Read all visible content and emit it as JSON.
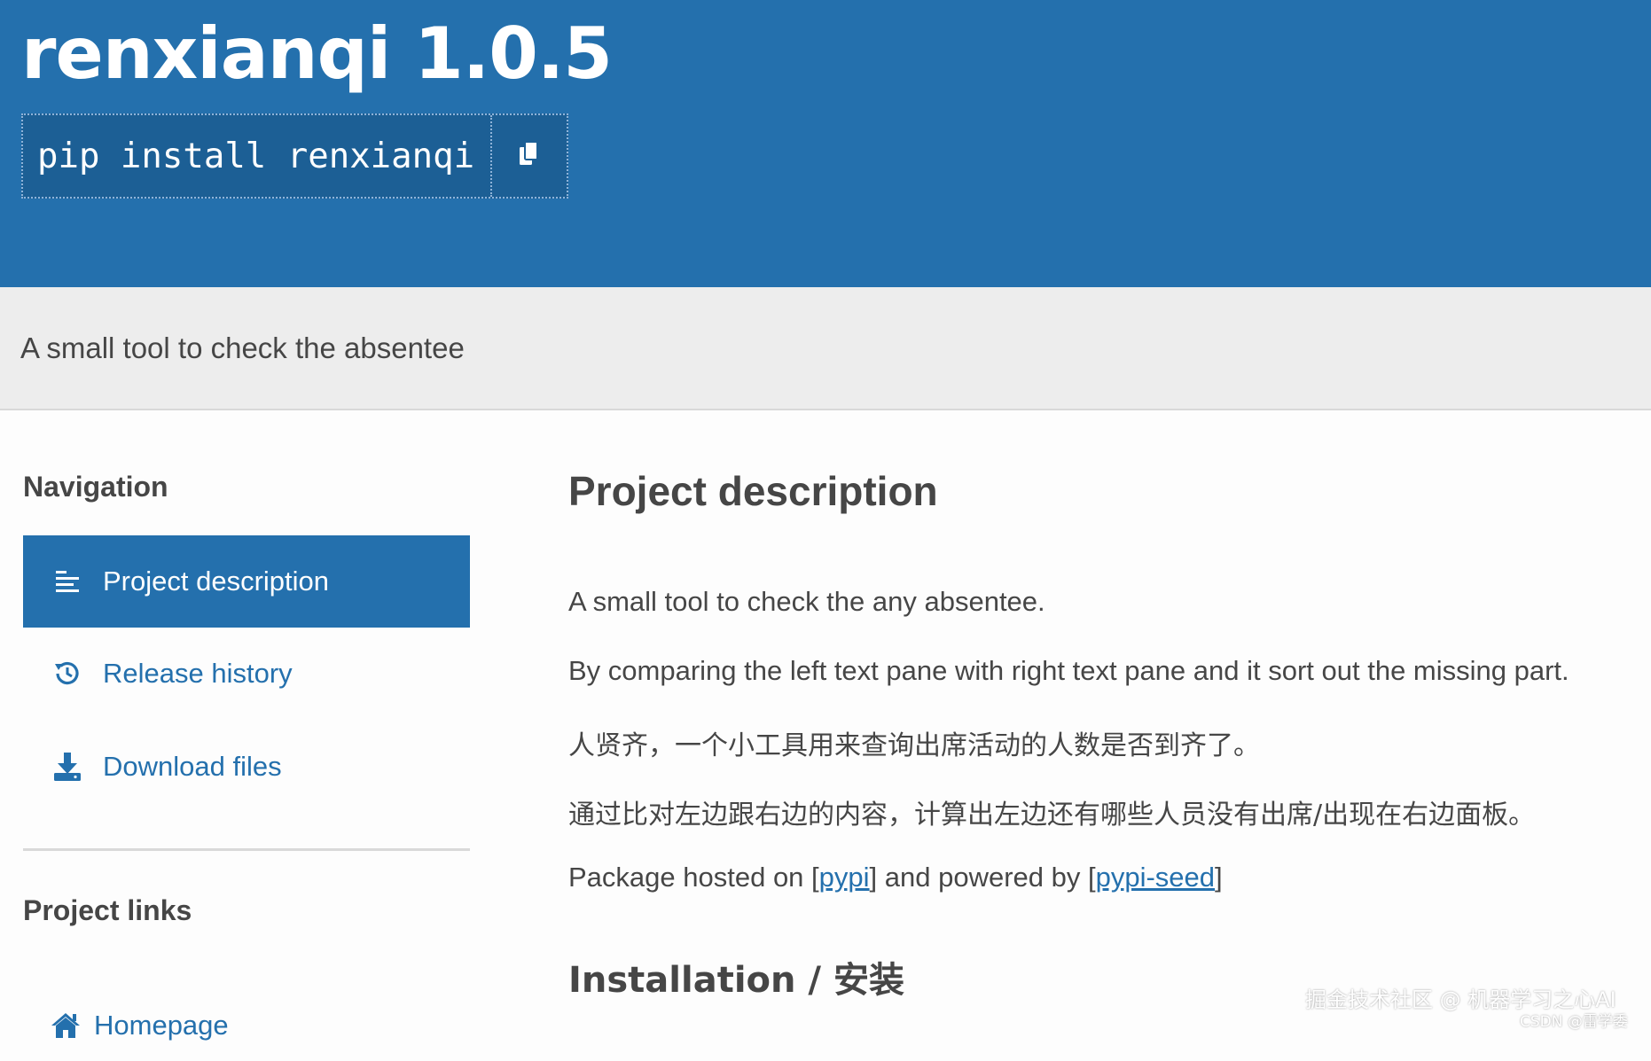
{
  "header": {
    "package_title": "renxianqi 1.0.5",
    "pip_command": "pip install renxianqi",
    "copy_icon": "copy-icon"
  },
  "summary": {
    "text": "A small tool to check the absentee"
  },
  "sidebar": {
    "navigation_heading": "Navigation",
    "nav_items": [
      {
        "label": "Project description",
        "icon": "align-left-icon",
        "active": true
      },
      {
        "label": "Release history",
        "icon": "history-icon",
        "active": false
      },
      {
        "label": "Download files",
        "icon": "download-icon",
        "active": false
      }
    ],
    "links_heading": "Project links",
    "links": [
      {
        "label": "Homepage",
        "icon": "home-icon"
      }
    ]
  },
  "main": {
    "heading": "Project description",
    "paragraphs": [
      "A small tool to check the any absentee.",
      "By comparing the left text pane with right text pane and it sort out the missing part.",
      "人贤齐，一个小工具用来查询出席活动的人数是否到齐了。",
      "通过比对左边跟右边的内容，计算出左边还有哪些人员没有出席/出现在右边面板。"
    ],
    "hosted": {
      "prefix": "Package hosted on [",
      "pypi_link": "pypi",
      "middle": "] and powered by [",
      "seed_link": "pypi-seed",
      "suffix": "]"
    },
    "installation_heading": "Installation / 安装"
  },
  "watermark": {
    "line1": "掘金技术社区 @ 机器学习之心AI",
    "line2": "CSDN @雷学委"
  },
  "colors": {
    "brand_blue": "#2470ad",
    "summary_band": "#ededed",
    "text": "#464646"
  }
}
